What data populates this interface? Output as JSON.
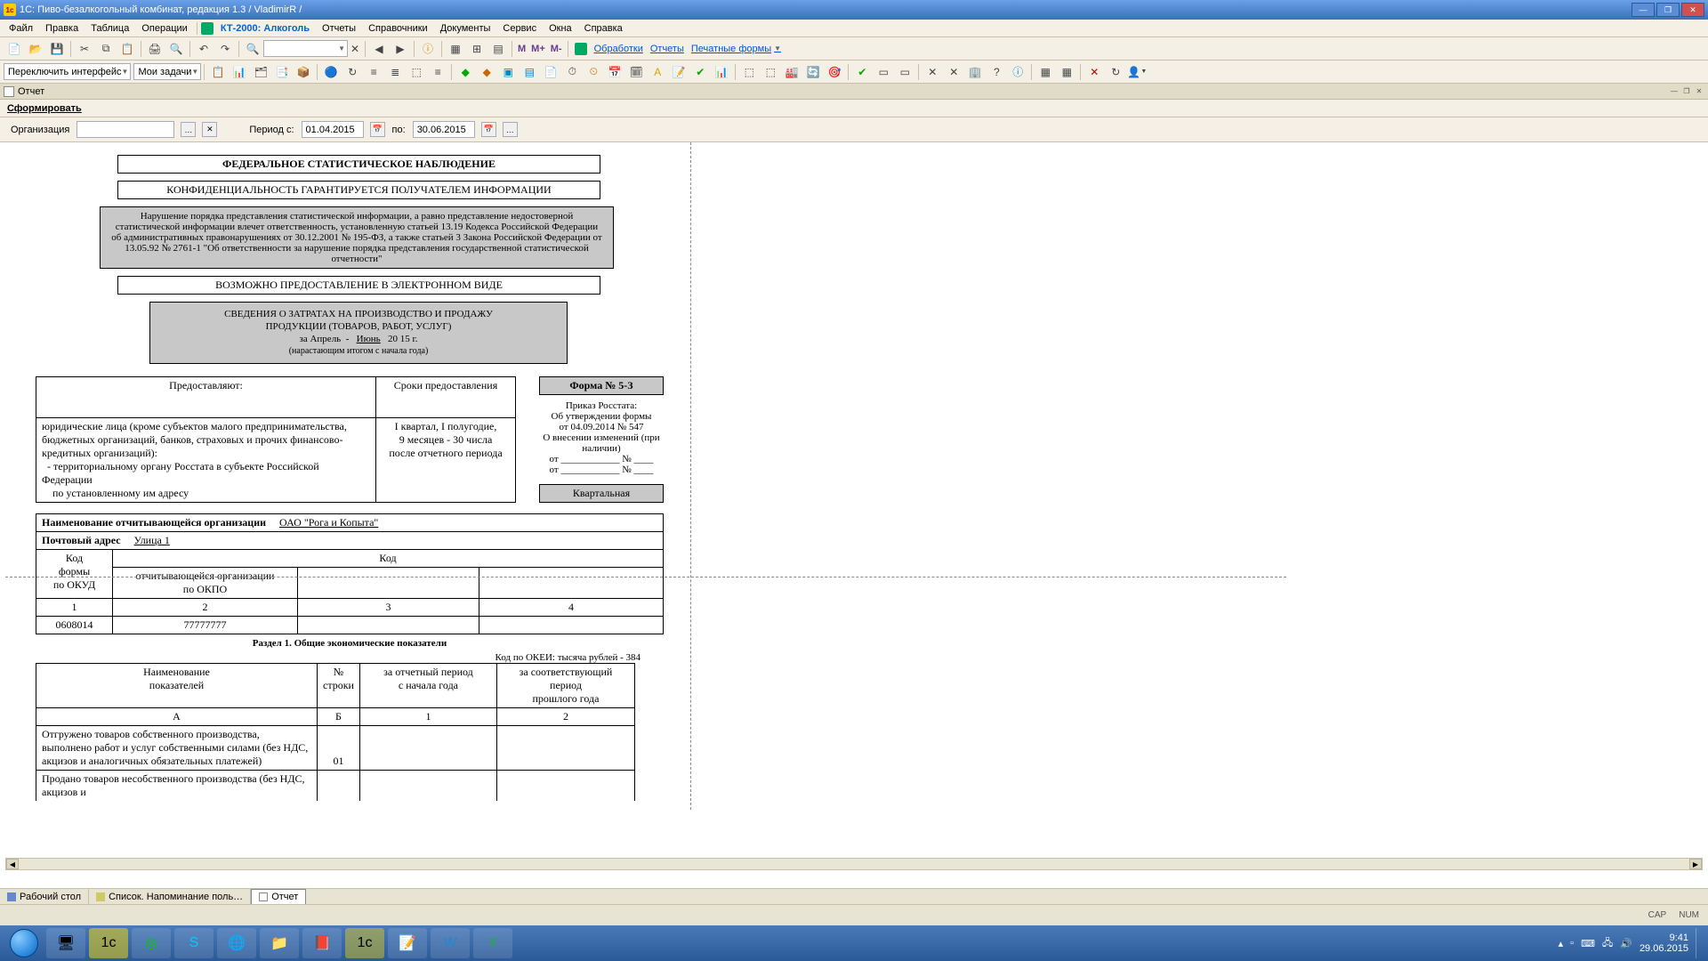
{
  "window": {
    "title": "1С: Пиво-безалкогольный комбинат, редакция 1.3 / VladimirR /"
  },
  "menu": [
    "Файл",
    "Правка",
    "Таблица",
    "Операции",
    "КТ-2000: Алкоголь",
    "Отчеты",
    "Справочники",
    "Документы",
    "Сервис",
    "Окна",
    "Справка"
  ],
  "toolbar1": {
    "links": [
      "Обработки",
      "Отчеты",
      "Печатные формы"
    ]
  },
  "toolbar2": {
    "switch": "Переключить интерфейс",
    "mytasks": "Мои задачи"
  },
  "inner": {
    "title": "Отчет"
  },
  "actionbar": {
    "form": "Сформировать"
  },
  "params": {
    "org_label": "Организация",
    "period_from_label": "Период с:",
    "period_from": "01.04.2015",
    "period_to_label": "по:",
    "period_to": "30.06.2015"
  },
  "report": {
    "h1": "ФЕДЕРАЛЬНОЕ СТАТИСТИЧЕСКОЕ НАБЛЮДЕНИЕ",
    "h2": "КОНФИДЕНЦИАЛЬНОСТЬ ГАРАНТИРУЕТСЯ ПОЛУЧАТЕЛЕМ ИНФОРМАЦИИ",
    "warning": "Нарушение порядка представления статистической информации, а равно представление недостоверной статистической информации влечет ответственность, установленную статьей 13.19 Кодекса Российской Федерации об административных правонарушениях от 30.12.2001 № 195-ФЗ, а также статьей 3 Закона Российской Федерации от 13.05.92 № 2761-1 \"Об ответственности за нарушение порядка представления государственной статистической отчетности\"",
    "eform": "ВОЗМОЖНО ПРЕДОСТАВЛЕНИЕ В ЭЛЕКТРОННОМ ВИДЕ",
    "title1": "СВЕДЕНИЯ О ЗАТРАТАХ НА ПРОИЗВОДСТВО И ПРОДАЖУ",
    "title2": "ПРОДУКЦИИ (ТОВАРОВ, РАБОТ, УСЛУГ)",
    "period_from": "за Апрель",
    "period_to": "Июнь",
    "year": "20 15",
    "year_suffix": "г.",
    "cumulative": "(нарастающим итогом с начала года)",
    "provide_header": "Предоставляют:",
    "deadline_header": "Сроки предоставления",
    "provide_body": "юридические лица (кроме субъектов малого предпринимательства, бюджетных организаций, банков, страховых и прочих финансово-кредитных организаций):\n  - территориальному органу Росстата в субъекте Российской Федерации\n    по установленному им адресу",
    "deadline_body": "I квартал, I полугодие,\n9 месяцев - 30 числа\nпосле отчетного периода",
    "form_no": "Форма № 5-З",
    "order1": "Приказ Росстата:",
    "order2": "Об утверждении формы",
    "order3": "от 04.09.2014 № 547",
    "order4": "О внесении изменений (при наличии)",
    "order5": "от ____________ № ____",
    "order6": "от ____________ № ____",
    "frequency": "Квартальная",
    "org_label": "Наименование отчитывающейся организации",
    "org_value": "ОАО \"Рога и Копыта\"",
    "addr_label": "Почтовый адрес",
    "addr_value": "Улица 1",
    "codes": {
      "h1": "Код",
      "h2": "формы",
      "h3": "по ОКУД",
      "h4": "Код",
      "h5": "отчитывающейся организации",
      "h6": "по ОКПО",
      "r1": "1",
      "r2": "2",
      "r3": "3",
      "r4": "4",
      "v1": "0608014",
      "v2": "77777777"
    },
    "section1": "Раздел 1. Общие экономические показатели",
    "okei": "Код по ОКЕИ: тысяча рублей - 384",
    "tbl1": {
      "h_name": "Наименование\nпоказателей",
      "h_row": "№\nстроки",
      "h_cur": "за отчетный период\nс начала года",
      "h_prev": "за соответствующий период\nпрошлого года",
      "a": "А",
      "b": "Б",
      "c1": "1",
      "c2": "2",
      "row1_name": "Отгружено товаров собственного производства, выполнено работ и услуг собственными силами (без НДС, акцизов и аналогичных обязательных платежей)",
      "row1_no": "01",
      "row2_name": "Продано товаров несобственного производства (без НДС, акцизов и"
    }
  },
  "docktabs": {
    "t1": "Рабочий стол",
    "t2": "Список. Напоминание поль…",
    "t3": "Отчет"
  },
  "status": {
    "cap": "CAP",
    "num": "NUM"
  },
  "tray": {
    "time": "9:41",
    "date": "29.06.2015"
  }
}
